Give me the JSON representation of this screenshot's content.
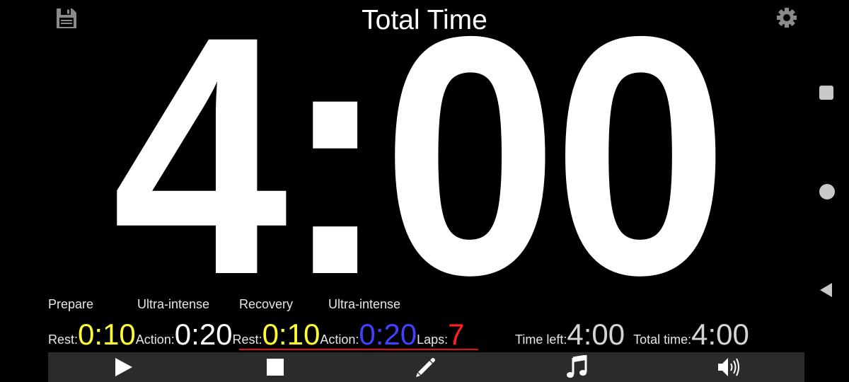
{
  "header": {
    "title": "Total Time"
  },
  "timer": {
    "display": "4:00"
  },
  "phases": [
    {
      "name": "Prepare"
    },
    {
      "name": "Ultra-intense"
    },
    {
      "name": "Recovery"
    },
    {
      "name": "Ultra-intense"
    }
  ],
  "stats": {
    "rest1_label": "Rest:",
    "rest1_value": "0:10",
    "action1_label": "Action:",
    "action1_value": "0:20",
    "rest2_label": "Rest:",
    "rest2_value": "0:10",
    "action2_label": "Action:",
    "action2_value": "0:20",
    "laps_label": "Laps: ",
    "laps_value": "7",
    "time_left_label": "Time left:",
    "time_left_value": "4:00",
    "total_time_label": "Total time:",
    "total_time_value": "4:00"
  },
  "toolbar": {
    "buttons": [
      "play-icon",
      "stop-icon",
      "pencil-icon",
      "music-note-icon",
      "volume-icon"
    ]
  },
  "navigation": {
    "buttons": [
      "recent-apps-icon",
      "home-icon",
      "back-icon"
    ]
  },
  "colors": {
    "background": "#000000",
    "rest": "#ffff33",
    "action_current": "#ffffff",
    "action_next": "#4040ff",
    "laps": "#ff2020",
    "toolbar": "#2b2b2b"
  }
}
